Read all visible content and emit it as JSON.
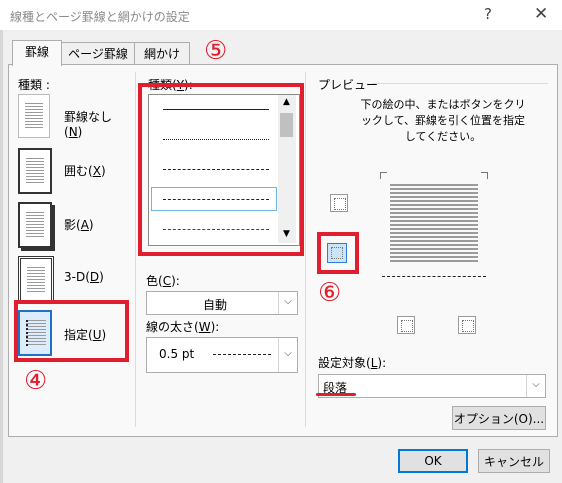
{
  "window": {
    "title": "線種とページ罫線と網かけの設定",
    "help": "?",
    "close": "✕"
  },
  "tabs": [
    {
      "label": "罫線",
      "active": true
    },
    {
      "label": "ページ罫線",
      "active": false
    },
    {
      "label": "網かけ",
      "active": false
    }
  ],
  "settings": {
    "label": "種類",
    "label_suffix": ":",
    "items": [
      {
        "label": "罫線なし",
        "key": "N"
      },
      {
        "label": "囲む",
        "key": "X"
      },
      {
        "label": "影",
        "key": "A"
      },
      {
        "label": "3-D",
        "key": "D"
      },
      {
        "label": "指定",
        "key": "U",
        "selected": true
      }
    ]
  },
  "style": {
    "label": "種類",
    "key": "Y",
    "label_suffix": ":",
    "lines": [
      "solid",
      "dotted",
      "dashed-small",
      "dashed",
      "dash-dot"
    ],
    "selected_index": 3
  },
  "color": {
    "label": "色",
    "key": "C",
    "value": "自動"
  },
  "width": {
    "label": "線の太さ",
    "key": "W",
    "value": "0.5 pt"
  },
  "preview": {
    "label": "プレビュー",
    "instructions": "下の絵の中、またはボタンをクリックして、罫線を引く位置を指定してください。"
  },
  "apply_to": {
    "label": "設定対象",
    "key": "L",
    "value": "段落"
  },
  "buttons": {
    "options": "オプション(O)...",
    "ok": "OK",
    "cancel": "キャンセル"
  },
  "annotations": [
    "④",
    "⑤",
    "⑥"
  ],
  "colors": {
    "highlight": "#e01e2e",
    "focus": "#0078d7"
  }
}
